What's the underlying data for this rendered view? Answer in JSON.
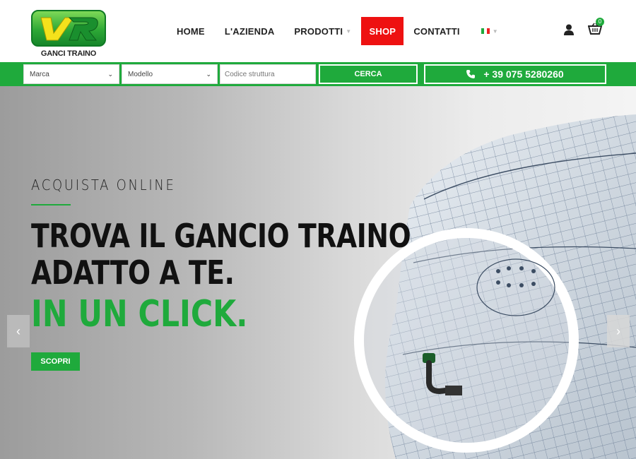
{
  "brand": {
    "logo_text": "GANCI TRAINO"
  },
  "nav": {
    "items": [
      {
        "label": "HOME"
      },
      {
        "label": "L'AZIENDA"
      },
      {
        "label": "PRODOTTI"
      },
      {
        "label": "SHOP"
      },
      {
        "label": "CONTATTI"
      }
    ],
    "language": "it"
  },
  "cart": {
    "count": "0"
  },
  "search": {
    "brand_select": "Marca",
    "model_select": "Modello",
    "code_placeholder": "Codice struttura",
    "search_button": "CERCA",
    "phone": "+ 39 075 5280260"
  },
  "hero": {
    "kicker": "ACQUISTA ONLINE",
    "headline_line1": "TROVA IL GANCIO TRAINO",
    "headline_line2": "ADATTO A TE.",
    "headline_accent": "IN UN CLICK.",
    "cta": "SCOPRI"
  },
  "colors": {
    "brand_green": "#1faa3c",
    "shop_red": "#ee1111",
    "text_dark": "#111111"
  },
  "icons": [
    "user-icon",
    "cart-icon",
    "phone-icon",
    "chevron-left-icon",
    "chevron-right-icon",
    "chevron-down-icon"
  ]
}
